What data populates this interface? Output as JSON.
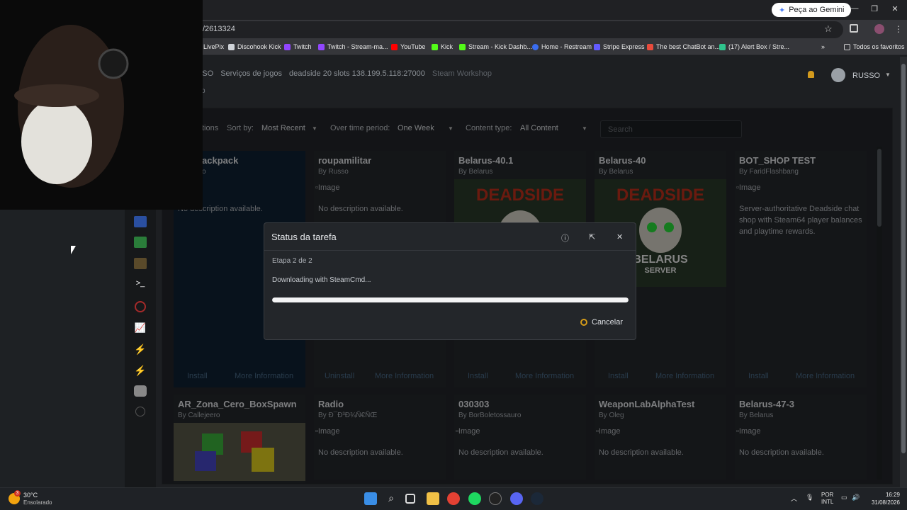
{
  "browser": {
    "gemini_label": "Peça ao Gemini",
    "url": "/2613324",
    "bookmarks": [
      "LivePix",
      "Discohook Kick",
      "Twitch",
      "Twitch - Stream-ma...",
      "YouTube",
      "Kick",
      "Stream - Kick Dashb...",
      "Home - Restream",
      "Stripe Express",
      "The best ChatBot an...",
      "(17) Alert Box / Stre..."
    ],
    "all_bookmarks": "Todos os favoritos"
  },
  "header": {
    "crumbs": [
      "USSO",
      "Serviços de jogos",
      "deadside 20 slots 138.199.5.118:27000",
      "Steam Workshop"
    ],
    "sub": "p",
    "user": "RUSSO"
  },
  "filters": {
    "options_label": "tions",
    "sort_label": "Sort by:",
    "sort_value": "Most Recent",
    "period_label": "Over time period:",
    "period_value": "One Week",
    "content_label": "Content type:",
    "content_value": "All Content",
    "search_placeholder": "Search"
  },
  "cards": [
    {
      "title": "ackpack",
      "by": "o",
      "img": "",
      "desc": "No description available.",
      "action": "Install",
      "more": "More Information"
    },
    {
      "title": "roupamilitar",
      "by": "By Russo",
      "img": "Image",
      "desc": "No description available.",
      "action": "Uninstall",
      "more": "More Information"
    },
    {
      "title": "Belarus-40.1",
      "by": "By Belarus",
      "img": "",
      "desc": "",
      "action": "Install",
      "more": "More Information"
    },
    {
      "title": "Belarus-40",
      "by": "By Belarus",
      "img": "",
      "desc": "",
      "action": "Install",
      "more": "More Information"
    },
    {
      "title": "BOT_SHOP TEST",
      "by": "By FaridFlashbang",
      "img": "Image",
      "desc": "Server-authoritative Deadside chat shop with Steam64 player balances and playtime rewards.",
      "action": "Install",
      "more": "More Information"
    }
  ],
  "cards_row2": [
    {
      "title": "AR_Zona_Cero_BoxSpawn",
      "by": "By Callejeero",
      "img": "",
      "desc": ""
    },
    {
      "title": "Radio",
      "by": "By Ð¯Ð³Ð¾Ñ€ÑŒ",
      "img": "Image",
      "desc": "No description available."
    },
    {
      "title": "030303",
      "by": "By BorBoletossauro",
      "img": "Image",
      "desc": "No description available."
    },
    {
      "title": "WeaponLabAlphaTest",
      "by": "By Oleg",
      "img": "Image",
      "desc": "No description available."
    },
    {
      "title": "Belarus-47-3",
      "by": "By Belarus",
      "img": "Image",
      "desc": "No description available."
    }
  ],
  "deadside_art": {
    "brand": "DEADSIDE",
    "belarus": "BELARUS",
    "server": "SERVER"
  },
  "modal": {
    "title": "Status da tarefa",
    "stage": "Etapa 2 de 2",
    "status": "Downloading with SteamCmd...",
    "progress": 1.0,
    "cancel": "Cancelar"
  },
  "taskbar": {
    "temp": "30°C",
    "weather": "Ensolarado",
    "weather_badge": "3",
    "lang1": "POR",
    "lang2": "INTL",
    "time": "16:29",
    "date": "31/08/2026"
  },
  "colors": {
    "accent": "#d39a1d",
    "selected_card": "#0f2233"
  }
}
